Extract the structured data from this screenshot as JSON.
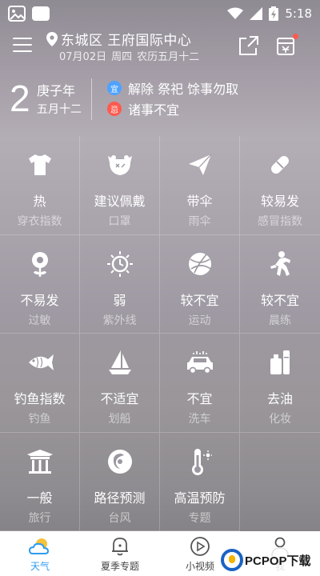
{
  "status_bar": {
    "time": "5:18"
  },
  "header": {
    "location": "东城区 王府国际中心",
    "date": "07月02日",
    "weekday": "周四",
    "lunar_full": "农历五月十二"
  },
  "almanac": {
    "day": "2",
    "ganzhi_year": "庚子年",
    "lunar_day": "五月十二",
    "yi_badge": "宜",
    "yi_text": "解除 祭祀 馀事勿取",
    "ji_badge": "忌",
    "ji_text": "诸事不宜"
  },
  "indices": [
    {
      "value": "热",
      "label": "穿衣指数",
      "icon": "tshirt-icon"
    },
    {
      "value": "建议佩戴",
      "label": "口罩",
      "icon": "mask-icon"
    },
    {
      "value": "带伞",
      "label": "雨伞",
      "icon": "paper-plane-icon"
    },
    {
      "value": "较易发",
      "label": "感冒指数",
      "icon": "pill-icon"
    },
    {
      "value": "不易发",
      "label": "过敏",
      "icon": "flower-icon"
    },
    {
      "value": "弱",
      "label": "紫外线",
      "icon": "sun-icon"
    },
    {
      "value": "较不宜",
      "label": "运动",
      "icon": "ball-icon"
    },
    {
      "value": "较不宜",
      "label": "晨练",
      "icon": "running-icon"
    },
    {
      "value": "钓鱼指数",
      "label": "钓鱼",
      "icon": "fish-icon"
    },
    {
      "value": "不适宜",
      "label": "划船",
      "icon": "sailboat-icon"
    },
    {
      "value": "不宜",
      "label": "洗车",
      "icon": "car-icon"
    },
    {
      "value": "去油",
      "label": "化妆",
      "icon": "cosmetics-icon"
    },
    {
      "value": "一般",
      "label": "旅行",
      "icon": "pavilion-icon"
    },
    {
      "value": "路径预测",
      "label": "台风",
      "icon": "typhoon-icon"
    },
    {
      "value": "高温预防",
      "label": "专题",
      "icon": "thermometer-icon"
    }
  ],
  "tabs": [
    {
      "label": "天气",
      "active": true
    },
    {
      "label": "夏季专题",
      "active": false
    },
    {
      "label": "小视频",
      "active": false
    },
    {
      "label": "我",
      "active": false
    }
  ],
  "watermark": "PCPOP下载",
  "colors": {
    "accent": "#2d9bf0",
    "yi": "#4da3ff",
    "ji": "#ff5a4e"
  }
}
